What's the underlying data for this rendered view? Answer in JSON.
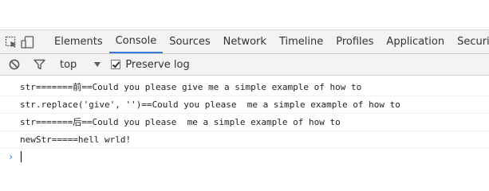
{
  "toolbar": {
    "inspect_icon": "inspect-element-icon",
    "device_icon": "device-mode-icon"
  },
  "tabs": [
    {
      "label": "Elements",
      "active": false
    },
    {
      "label": "Console",
      "active": true
    },
    {
      "label": "Sources",
      "active": false
    },
    {
      "label": "Network",
      "active": false
    },
    {
      "label": "Timeline",
      "active": false
    },
    {
      "label": "Profiles",
      "active": false
    },
    {
      "label": "Application",
      "active": false
    },
    {
      "label": "Security",
      "active": false
    }
  ],
  "filterbar": {
    "clear_icon": "clear-console-icon",
    "filter_icon": "filter-icon",
    "context": "top",
    "preserve_log_label": "Preserve log",
    "preserve_log_checked": true
  },
  "console": {
    "lines": [
      "str=======前==Could you please give me a simple example of how to",
      "str.replace('give', '')==Could you please  me a simple example of how to",
      "str=======后==Could you please  me a simple example of how to",
      "newStr=====hell wrld!"
    ],
    "prompt_symbol": "›"
  },
  "colors": {
    "toolbar_bg": "#f3f3f3",
    "active_tab_underline": "#3879d9",
    "prompt": "#367cf1"
  }
}
